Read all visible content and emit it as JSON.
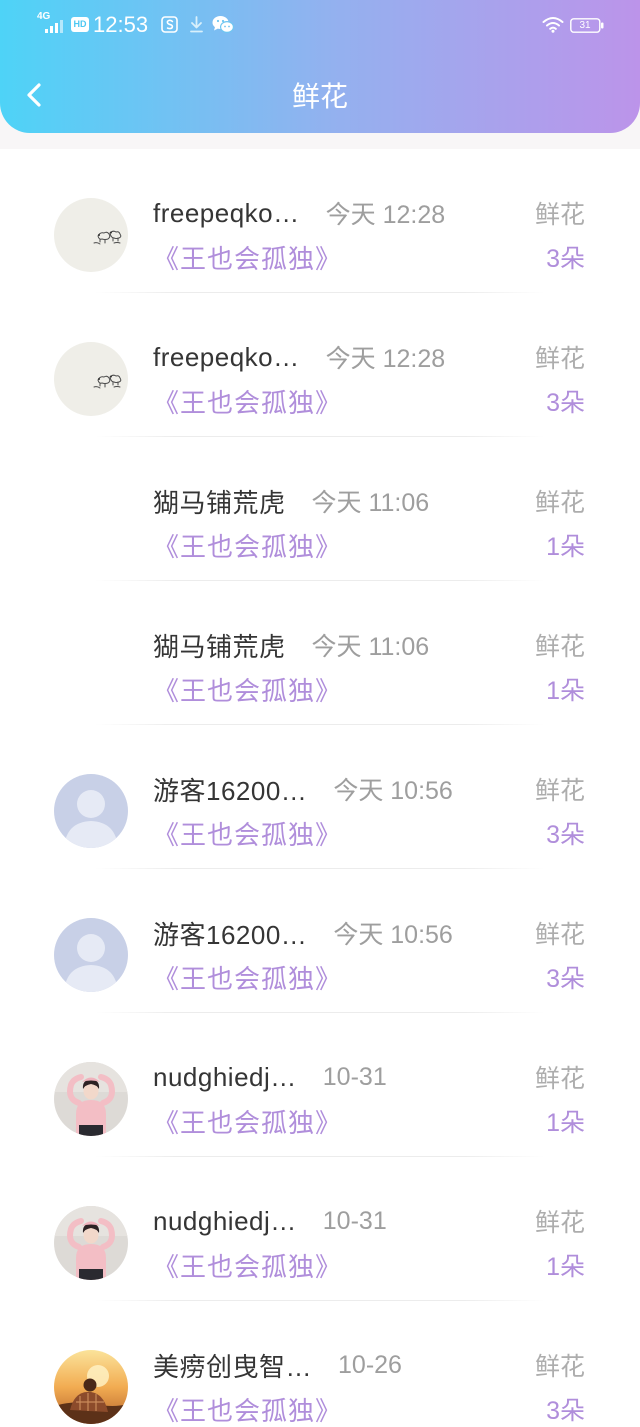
{
  "status_bar": {
    "network": "4G",
    "hd_badge": "HD",
    "time": "12:53",
    "battery_level": "31",
    "icons": [
      "signal-icon",
      "s-app-icon",
      "download-icon",
      "wechat-icon",
      "wifi-icon",
      "battery-icon"
    ]
  },
  "header": {
    "back_icon": "chevron-left-icon",
    "title": "鲜花"
  },
  "theme": {
    "gradient_start": "#4ed3f7",
    "gradient_end": "#bc94ea",
    "accent": "#b08edb",
    "name_color": "#353535",
    "meta_color": "#9e9e9e"
  },
  "gifts": [
    {
      "avatar": "sketch-avatar",
      "name": "freepeqko…",
      "time": "今天 12:28",
      "gift": "鲜花",
      "book": "《王也会孤独》",
      "count": "3朵"
    },
    {
      "avatar": "sketch-avatar",
      "name": "freepeqko…",
      "time": "今天 12:28",
      "gift": "鲜花",
      "book": "《王也会孤独》",
      "count": "3朵"
    },
    {
      "avatar": null,
      "name": "猢马铺荒虎",
      "time": "今天 11:06",
      "gift": "鲜花",
      "book": "《王也会孤独》",
      "count": "1朵"
    },
    {
      "avatar": null,
      "name": "猢马铺荒虎",
      "time": "今天 11:06",
      "gift": "鲜花",
      "book": "《王也会孤独》",
      "count": "1朵"
    },
    {
      "avatar": "default-person-avatar",
      "name": "游客16200…",
      "time": "今天 10:56",
      "gift": "鲜花",
      "book": "《王也会孤独》",
      "count": "3朵"
    },
    {
      "avatar": "default-person-avatar",
      "name": "游客16200…",
      "time": "今天 10:56",
      "gift": "鲜花",
      "book": "《王也会孤独》",
      "count": "3朵"
    },
    {
      "avatar": "pink-photo-avatar",
      "name": "nudghiedj…",
      "time": "10-31",
      "gift": "鲜花",
      "book": "《王也会孤独》",
      "count": "1朵"
    },
    {
      "avatar": "pink-photo-avatar",
      "name": "nudghiedj…",
      "time": "10-31",
      "gift": "鲜花",
      "book": "《王也会孤独》",
      "count": "1朵"
    },
    {
      "avatar": "sunset-photo-avatar",
      "name": "美痨创曳智…",
      "time": "10-26",
      "gift": "鲜花",
      "book": "《王也会孤独》",
      "count": "3朵"
    }
  ]
}
